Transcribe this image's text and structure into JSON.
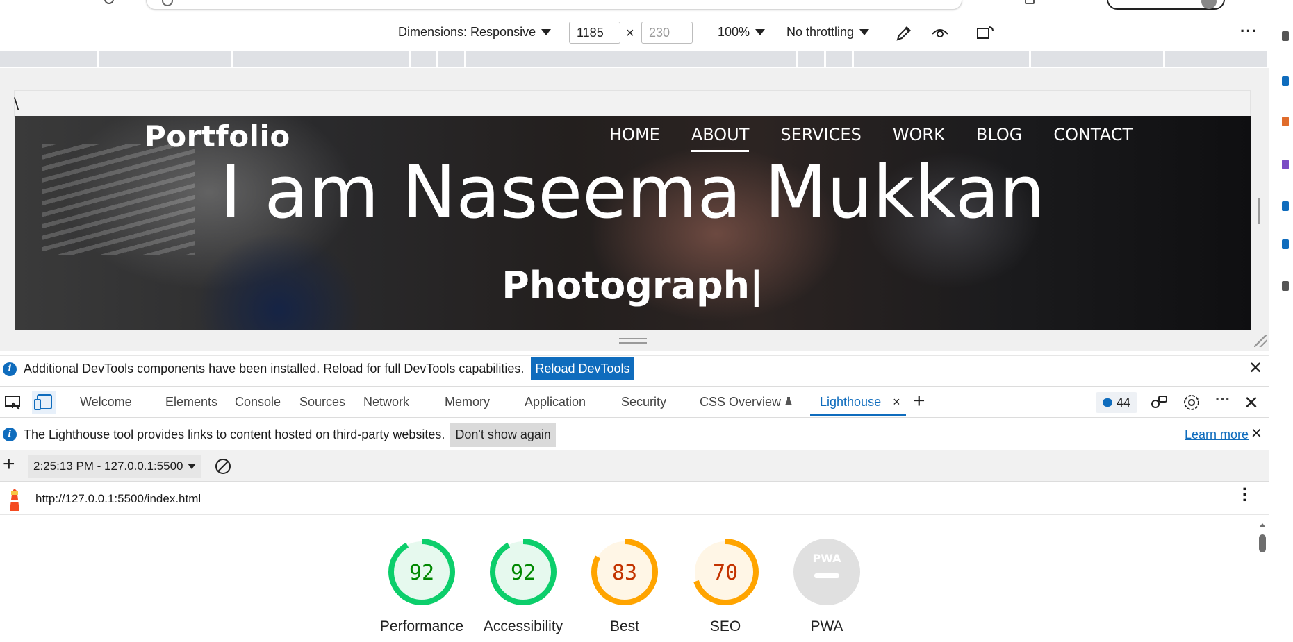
{
  "device_toolbar": {
    "dimensions_label": "Dimensions: Responsive",
    "width_value": "1185",
    "height_placeholder": "230",
    "times": "×",
    "zoom": "100%",
    "throttling": "No throttling",
    "more": "···"
  },
  "site": {
    "stray_char": "\\",
    "logo": "Portfolio",
    "nav": [
      "HOME",
      "ABOUT",
      "SERVICES",
      "WORK",
      "BLOG",
      "CONTACT"
    ],
    "active_nav": "ABOUT",
    "title": "I am Naseema Mukkan",
    "subtitle": "Photograph|"
  },
  "infobar": {
    "message": "Additional DevTools components have been installed. Reload for full DevTools capabilities.",
    "reload_label": "Reload DevTools",
    "close": "✕"
  },
  "tabs": {
    "items": [
      "Welcome",
      "Elements",
      "Console",
      "Sources",
      "Network",
      "Memory",
      "Application",
      "Security",
      "CSS Overview",
      "Lighthouse"
    ],
    "active": "Lighthouse",
    "close": "×",
    "add": "+",
    "issues_count": "44"
  },
  "lighthouse_info": {
    "message": "The Lighthouse tool provides links to content hosted on third-party websites.",
    "dont_show": "Don't show again",
    "learn_more": "Learn more",
    "close": "✕"
  },
  "report": {
    "selector": "2:25:13 PM - 127.0.0.1:5500",
    "add": "+",
    "url": "http://127.0.0.1:5500/index.html"
  },
  "scores": [
    {
      "label": "Performance",
      "score": 92,
      "color": "#0cce6b",
      "text_color": "#008800",
      "bg": "#e6f9ee"
    },
    {
      "label": "Accessibility",
      "score": 92,
      "color": "#0cce6b",
      "text_color": "#008800",
      "bg": "#e6f9ee"
    },
    {
      "label": "Best",
      "score": 83,
      "color": "#ffa400",
      "text_color": "#c33300",
      "bg": "#fff6e6"
    },
    {
      "label": "SEO",
      "score": 70,
      "color": "#ffa400",
      "text_color": "#c33300",
      "bg": "#fff6e6"
    },
    {
      "label": "PWA",
      "score": null,
      "pwa_text": "PWA",
      "color": "#cccccc",
      "bg": "#e0e0e0"
    }
  ],
  "colors": {
    "accent": "#0f6cbd"
  }
}
